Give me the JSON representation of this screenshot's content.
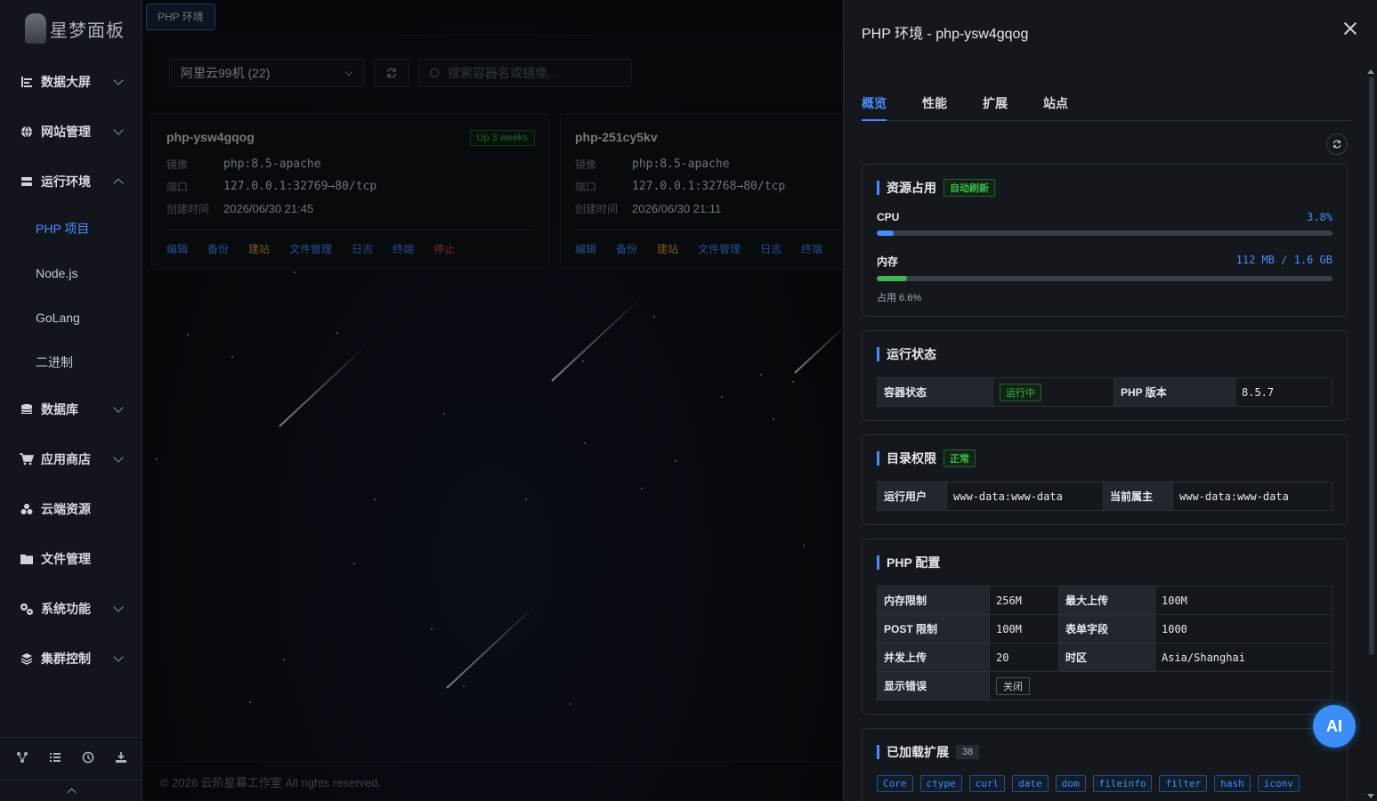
{
  "sidebar": {
    "logo_text": "星梦面板",
    "items": [
      {
        "label": "数据大屏",
        "icon": "chart-icon"
      },
      {
        "label": "网站管理",
        "icon": "globe-icon"
      },
      {
        "label": "运行环境",
        "icon": "server-icon"
      },
      {
        "label": "数据库",
        "icon": "database-icon"
      },
      {
        "label": "应用商店",
        "icon": "cart-icon"
      },
      {
        "label": "云端资源",
        "icon": "cloud-icon"
      },
      {
        "label": "文件管理",
        "icon": "folder-icon"
      },
      {
        "label": "系统功能",
        "icon": "gears-icon"
      },
      {
        "label": "集群控制",
        "icon": "layers-icon"
      }
    ],
    "sub_items": [
      "PHP 项目",
      "Node.js",
      "GoLang",
      "二进制"
    ]
  },
  "main": {
    "tab_label": "PHP 环境",
    "server_select": "阿里云99机 (22)",
    "search_placeholder": "搜索容器名或镜像...",
    "cards": [
      {
        "name": "php-ysw4gqog",
        "status": "Up 3 weeks",
        "image_label": "镜像",
        "image": "php:8.5-apache",
        "port_label": "端口",
        "port": "127.0.0.1:32769→80/tcp",
        "created_label": "创建时间",
        "created": "2026/06/30 21:45",
        "actions": [
          "编辑",
          "备份",
          "建站",
          "文件管理",
          "日志",
          "终端",
          "停止"
        ]
      },
      {
        "name": "php-251cy5kv",
        "image_label": "镜像",
        "image": "php:8.5-apache",
        "port_label": "端口",
        "port": "127.0.0.1:32768→80/tcp",
        "created_label": "创建时间",
        "created": "2026/06/30 21:11",
        "actions": [
          "编辑",
          "备份",
          "建站",
          "文件管理",
          "日志",
          "终端"
        ]
      }
    ],
    "footer": "© 2026 云阶星幕工作室 All rights reserved."
  },
  "drawer": {
    "title": "PHP 环境 - php-ysw4gqog",
    "tabs": [
      "概览",
      "性能",
      "扩展",
      "站点"
    ],
    "resource": {
      "title": "资源占用",
      "auto_tag": "自动刷新",
      "cpu_label": "CPU",
      "cpu_value": "3.8%",
      "cpu_fraction": 0.038,
      "mem_label": "内存",
      "mem_value": "112 MB / 1.6 GB",
      "mem_fraction": 0.066,
      "mem_sub": "占用 6.6%"
    },
    "runtime": {
      "title": "运行状态",
      "container_label": "容器状态",
      "container_value": "运行中",
      "php_label": "PHP 版本",
      "php_value": "8.5.7"
    },
    "dirperm": {
      "title": "目录权限",
      "tag": "正常",
      "user_label": "运行用户",
      "user_value": "www-data:www-data",
      "owner_label": "当前属主",
      "owner_value": "www-data:www-data"
    },
    "phpconf": {
      "title": "PHP 配置",
      "rows": [
        [
          "内存限制",
          "256M",
          "最大上传",
          "100M"
        ],
        [
          "POST 限制",
          "100M",
          "表单字段",
          "1000"
        ],
        [
          "并发上传",
          "20",
          "时区",
          "Asia/Shanghai"
        ]
      ],
      "display_errors_label": "显示错误",
      "display_errors_value": "关闭"
    },
    "extensions": {
      "title": "已加载扩展",
      "count": "38",
      "items": [
        "Core",
        "ctype",
        "curl",
        "date",
        "dom",
        "fileinfo",
        "filter",
        "hash",
        "iconv"
      ]
    },
    "ai_label": "AI"
  },
  "colors": {
    "accent": "#4a8cff",
    "success": "#3fb950",
    "danger": "#f0483e",
    "warn": "#e09a3e"
  }
}
